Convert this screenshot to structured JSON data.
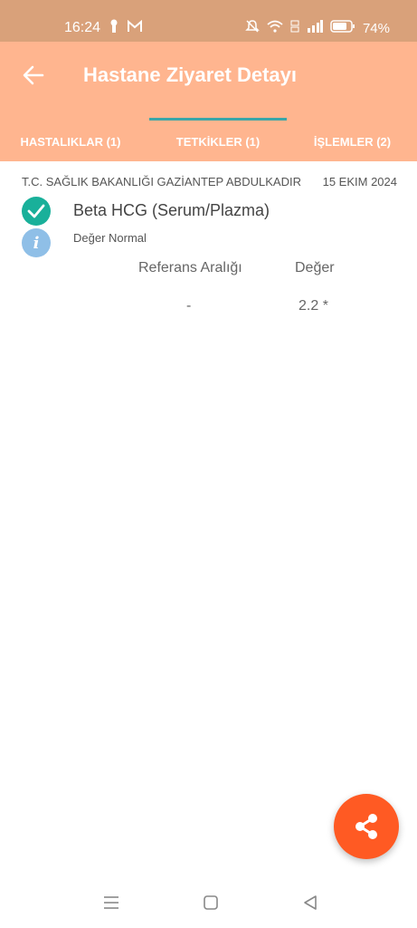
{
  "status_bar": {
    "time": "16:24",
    "battery": "74%",
    "icons": [
      "lock-icon",
      "mail-icon",
      "mute-icon",
      "wifi-icon",
      "volte-icon",
      "signal-icon",
      "battery-icon"
    ]
  },
  "app_bar": {
    "title": "Hastane Ziyaret Detayı",
    "background": "#ffb58f"
  },
  "tabs": [
    {
      "label": "HASTALIKLAR (1)",
      "selected": false
    },
    {
      "label": "TETKİKLER (1)",
      "selected": true
    },
    {
      "label": "İŞLEMLER (2)",
      "selected": false
    }
  ],
  "result": {
    "organization": "T.C. SAĞLIK BAKANLIĞI GAZİANTEP ABDULKADIR",
    "date": "15 EKIM 2024",
    "test_name": "Beta HCG (Serum/Plazma)",
    "status": "Değer Normal",
    "columns": {
      "reference": "Referans Aralığı",
      "value": "Değer"
    },
    "row": {
      "reference": "-",
      "value": "2.2 *"
    }
  },
  "fab": {
    "icon": "share-icon",
    "color": "#ff5a23"
  },
  "nav_bar": {
    "icons": [
      "menu-icon",
      "home-icon",
      "back-icon"
    ]
  }
}
